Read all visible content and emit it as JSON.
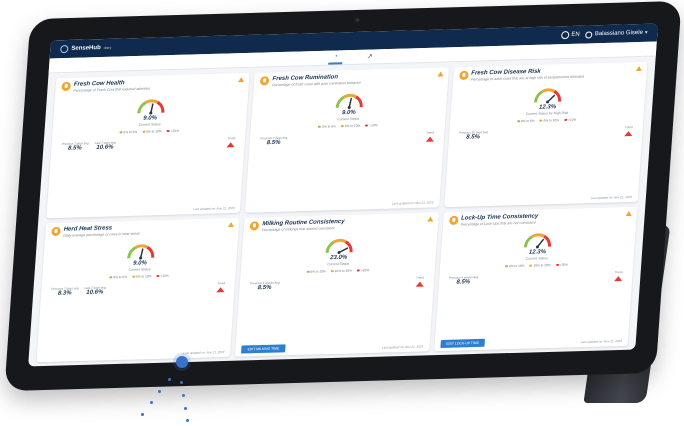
{
  "header": {
    "brand": "SenseHub",
    "brand_sub": "dairy",
    "language": "EN",
    "user": "Balassiano Gisele"
  },
  "tabs": [
    {
      "icon": "gauge-icon",
      "active": true
    },
    {
      "icon": "graph-icon",
      "active": false
    }
  ],
  "labels": {
    "current_status": "Current Status",
    "trend": "Trend"
  },
  "cards": [
    {
      "title": "Fresh Cow Health",
      "desc": "Percentage of Fresh Cow that required attention",
      "value": "9.0%",
      "legend": [
        "0% to 6%",
        "6% to 10%",
        ">10%"
      ],
      "stats": [
        {
          "label": "Previous 7 days avg",
          "value": "8.5%"
        },
        {
          "label": "Last 7 days avg",
          "value": "10.6%"
        }
      ],
      "updated": "Last updated on: Nov 21, 2023",
      "button": "",
      "needle": 0.55
    },
    {
      "title": "Fresh Cow Rumination",
      "desc": "Percentage of fresh cows with poor rumination behavior",
      "value": "9.0%",
      "legend": [
        "0% to 6%",
        "6% to 10%",
        ">10%"
      ],
      "stats": [
        {
          "label": "Previous 7 days avg",
          "value": "8.5%"
        }
      ],
      "updated": "Last updated on: Nov 21, 2023",
      "button": "",
      "needle": 0.55
    },
    {
      "title": "Fresh Cow Disease Risk",
      "desc": "Percentage of adult cows that are at high risk of periparturient diseases",
      "value": "12.3%",
      "status": "Current Status for High Risk",
      "legend": [
        "0% to 6%",
        "6% to 10%",
        ">10%"
      ],
      "stats": [
        {
          "label": "Previous 30 days avg",
          "value": "8.5%"
        }
      ],
      "updated": "Last updated on: Nov 21, 2023",
      "button": "",
      "needle": 0.75
    },
    {
      "title": "Herd Heat Stress",
      "desc": "Daily average percentage of cows in heat stress",
      "value": "9.0%",
      "legend": [
        "0% to 6%",
        "6% to 10%",
        ">10%"
      ],
      "stats": [
        {
          "label": "Previous 7 days avg",
          "value": "8.3%"
        },
        {
          "label": "Last 7 days avg",
          "value": "10.6%"
        }
      ],
      "updated": "Last updated on: Nov 21, 2023",
      "button": "",
      "needle": 0.55
    },
    {
      "title": "Milking Routine Consistency",
      "desc": "Percentage of milkings that started consistent",
      "value": "23.0%",
      "legend": [
        "0% to 10%",
        "10% to 20%",
        ">20%"
      ],
      "stats": [
        {
          "label": "Previous 4 weeks Avg",
          "value": "8.5%"
        }
      ],
      "updated": "Last updated on: Nov 21, 2023",
      "button": "EDIT MILKING TIME",
      "needle": 0.85
    },
    {
      "title": "Lock-Up Time Consistency",
      "desc": "Percentage of Lock-Ups that are not consistent",
      "value": "12.3%",
      "legend": [
        "0% to 10%",
        "10% to 20%",
        ">20%"
      ],
      "stats": [
        {
          "label": "Previous 4 weeks Avg",
          "value": "8.5%"
        }
      ],
      "updated": "Last updated on: Nov 21, 2023",
      "button": "EDIT LOCK-UP TIME",
      "needle": 0.7
    }
  ]
}
